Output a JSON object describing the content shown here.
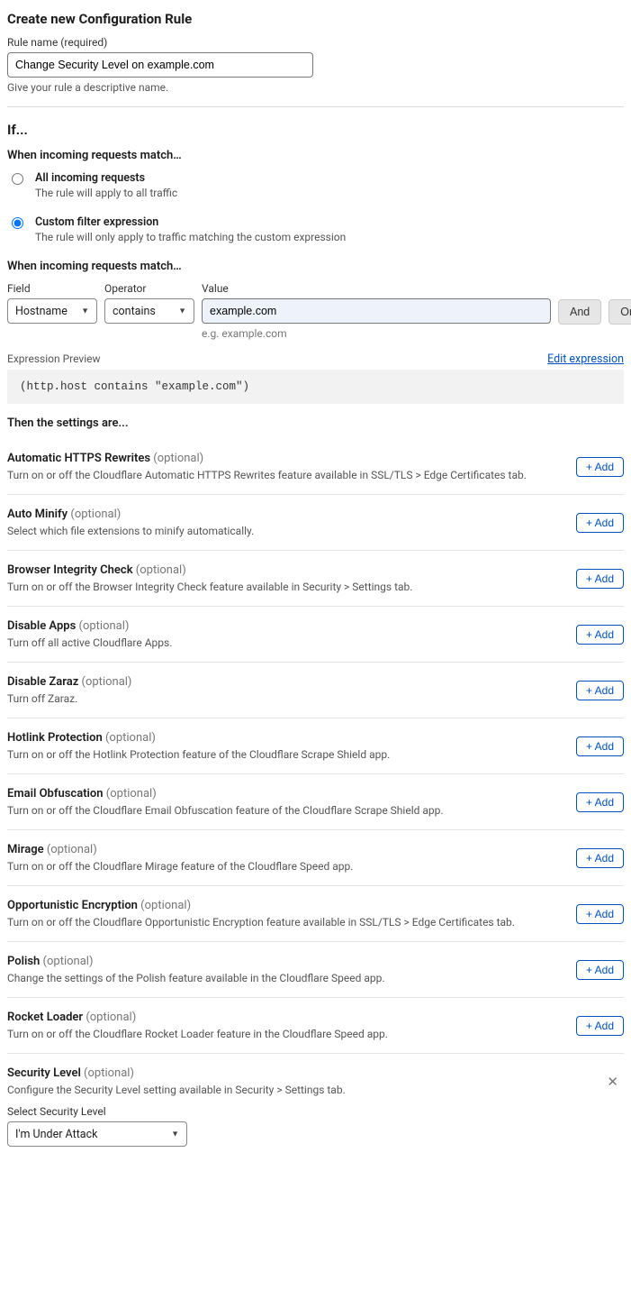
{
  "title": "Create new Configuration Rule",
  "rule_name": {
    "label": "Rule name (required)",
    "value": "Change Security Level on example.com",
    "helper": "Give your rule a descriptive name."
  },
  "if_heading": "If...",
  "match_heading": "When incoming requests match…",
  "radios": {
    "all": {
      "label": "All incoming requests",
      "sub": "The rule will apply to all traffic"
    },
    "custom": {
      "label": "Custom filter expression",
      "sub": "The rule will only apply to traffic matching the custom expression"
    }
  },
  "match_heading2": "When incoming requests match…",
  "filter": {
    "field_label": "Field",
    "operator_label": "Operator",
    "value_label": "Value",
    "field_value": "Hostname",
    "operator_value": "contains",
    "value_value": "example.com",
    "value_helper": "e.g. example.com",
    "and_label": "And",
    "or_label": "Or"
  },
  "expr": {
    "label": "Expression Preview",
    "edit": "Edit expression",
    "content": "(http.host contains \"example.com\")"
  },
  "then_heading": "Then the settings are...",
  "add_label": "+ Add",
  "settings": [
    {
      "title": "Automatic HTTPS Rewrites",
      "optional": " (optional)",
      "desc": "Turn on or off the Cloudflare Automatic HTTPS Rewrites feature available in SSL/TLS > Edge Certificates tab.",
      "action": "add"
    },
    {
      "title": "Auto Minify",
      "optional": " (optional)",
      "desc": "Select which file extensions to minify automatically.",
      "action": "add"
    },
    {
      "title": "Browser Integrity Check",
      "optional": " (optional)",
      "desc": "Turn on or off the Browser Integrity Check feature available in Security > Settings tab.",
      "action": "add"
    },
    {
      "title": "Disable Apps",
      "optional": " (optional)",
      "desc": "Turn off all active Cloudflare Apps.",
      "action": "add"
    },
    {
      "title": "Disable Zaraz",
      "optional": " (optional)",
      "desc": "Turn off Zaraz.",
      "action": "add"
    },
    {
      "title": "Hotlink Protection",
      "optional": " (optional)",
      "desc": "Turn on or off the Hotlink Protection feature of the Cloudflare Scrape Shield app.",
      "action": "add"
    },
    {
      "title": "Email Obfuscation",
      "optional": " (optional)",
      "desc": "Turn on or off the Cloudflare Email Obfuscation feature of the Cloudflare Scrape Shield app.",
      "action": "add"
    },
    {
      "title": "Mirage",
      "optional": " (optional)",
      "desc": "Turn on or off the Cloudflare Mirage feature of the Cloudflare Speed app.",
      "action": "add"
    },
    {
      "title": "Opportunistic Encryption",
      "optional": " (optional)",
      "desc": "Turn on or off the Cloudflare Opportunistic Encryption feature available in SSL/TLS > Edge Certificates tab.",
      "action": "add"
    },
    {
      "title": "Polish",
      "optional": " (optional)",
      "desc": "Change the settings of the Polish feature available in the Cloudflare Speed app.",
      "action": "add"
    },
    {
      "title": "Rocket Loader",
      "optional": " (optional)",
      "desc": "Turn on or off the Cloudflare Rocket Loader feature in the Cloudflare Speed app.",
      "action": "add"
    },
    {
      "title": "Security Level",
      "optional": " (optional)",
      "desc": "Configure the Security Level setting available in Security > Settings tab.",
      "action": "close"
    }
  ],
  "security_level": {
    "label": "Select Security Level",
    "value": "I'm Under Attack"
  }
}
